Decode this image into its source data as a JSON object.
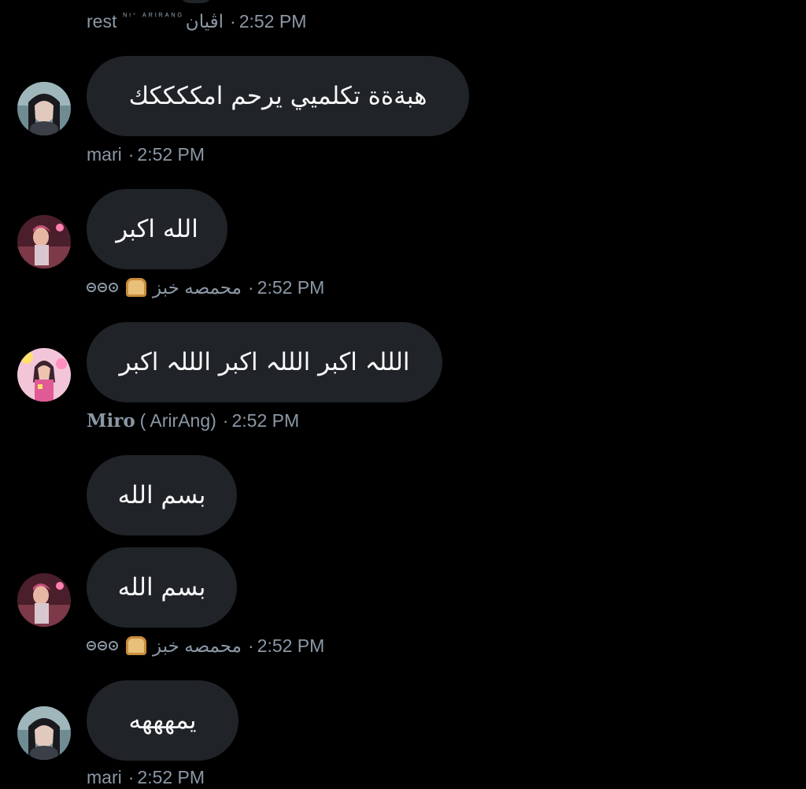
{
  "messages": [
    {
      "meta": {
        "name": "rest",
        "handle_small": "ᴺʳ' ᴬᴿᴵᴿᴬᴺᴳ",
        "handle_arabic": "اڤيان",
        "time": "2:52 PM"
      }
    },
    {
      "text": "هبةةة تكلميي يرحم امككككك",
      "avatar": "mari-avatar",
      "meta": {
        "name": "mari",
        "time": "2:52 PM"
      }
    },
    {
      "text": "الله اكبر",
      "avatar": "bread-avatar",
      "meta": {
        "name": "محمصه خبز",
        "time": "2:52 PM",
        "emoji": "bread-emoji",
        "circles": "⊖⊜⊙"
      }
    },
    {
      "text": "الللہ اكبر الللہ اكبر الللہ اكبر",
      "avatar": "miro-avatar",
      "meta": {
        "name_bold": "Miro",
        "name_rest": "( ArirAng)",
        "time": "2:52 PM"
      }
    },
    {
      "text": "بسم الله"
    },
    {
      "text": "بسم الله",
      "avatar": "bread-avatar",
      "meta": {
        "name": "محمصه خبز",
        "time": "2:52 PM",
        "emoji": "bread-emoji",
        "circles": "⊖⊜⊙"
      }
    },
    {
      "text": "يمهههه",
      "avatar": "mari-avatar",
      "meta": {
        "name": "mari",
        "time": "2:52 PM"
      }
    }
  ],
  "separator": "·",
  "colors": {
    "background": "#000000",
    "bubble": "#202327",
    "meta_text": "#8b98a5",
    "message_text": "#f7f9f9"
  }
}
